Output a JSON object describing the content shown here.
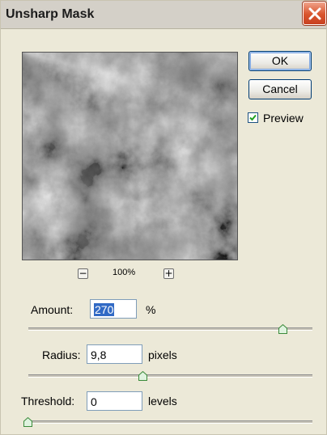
{
  "dialog": {
    "title": "Unsharp Mask"
  },
  "buttons": {
    "ok": "OK",
    "cancel": "Cancel"
  },
  "preview_checkbox": {
    "label": "Preview",
    "checked": true
  },
  "zoom": {
    "level": "100%",
    "minus": "−",
    "plus": "+"
  },
  "amount": {
    "label": "Amount:",
    "value": "270",
    "unit": "%",
    "slider_fraction": 0.89
  },
  "radius": {
    "label": "Radius:",
    "value": "9,8",
    "unit": "pixels",
    "slider_fraction": 0.4
  },
  "threshold": {
    "label": "Threshold:",
    "value": "0",
    "unit": "levels",
    "slider_fraction": 0.0
  },
  "colors": {
    "face": "#ece9d8",
    "accent": "#316ac5",
    "close": "#d9542c",
    "thumb": "#4caf50"
  },
  "icons": {
    "close": "close-icon",
    "check": "check-icon",
    "zoom_out": "zoom-out-icon",
    "zoom_in": "zoom-in-icon"
  }
}
